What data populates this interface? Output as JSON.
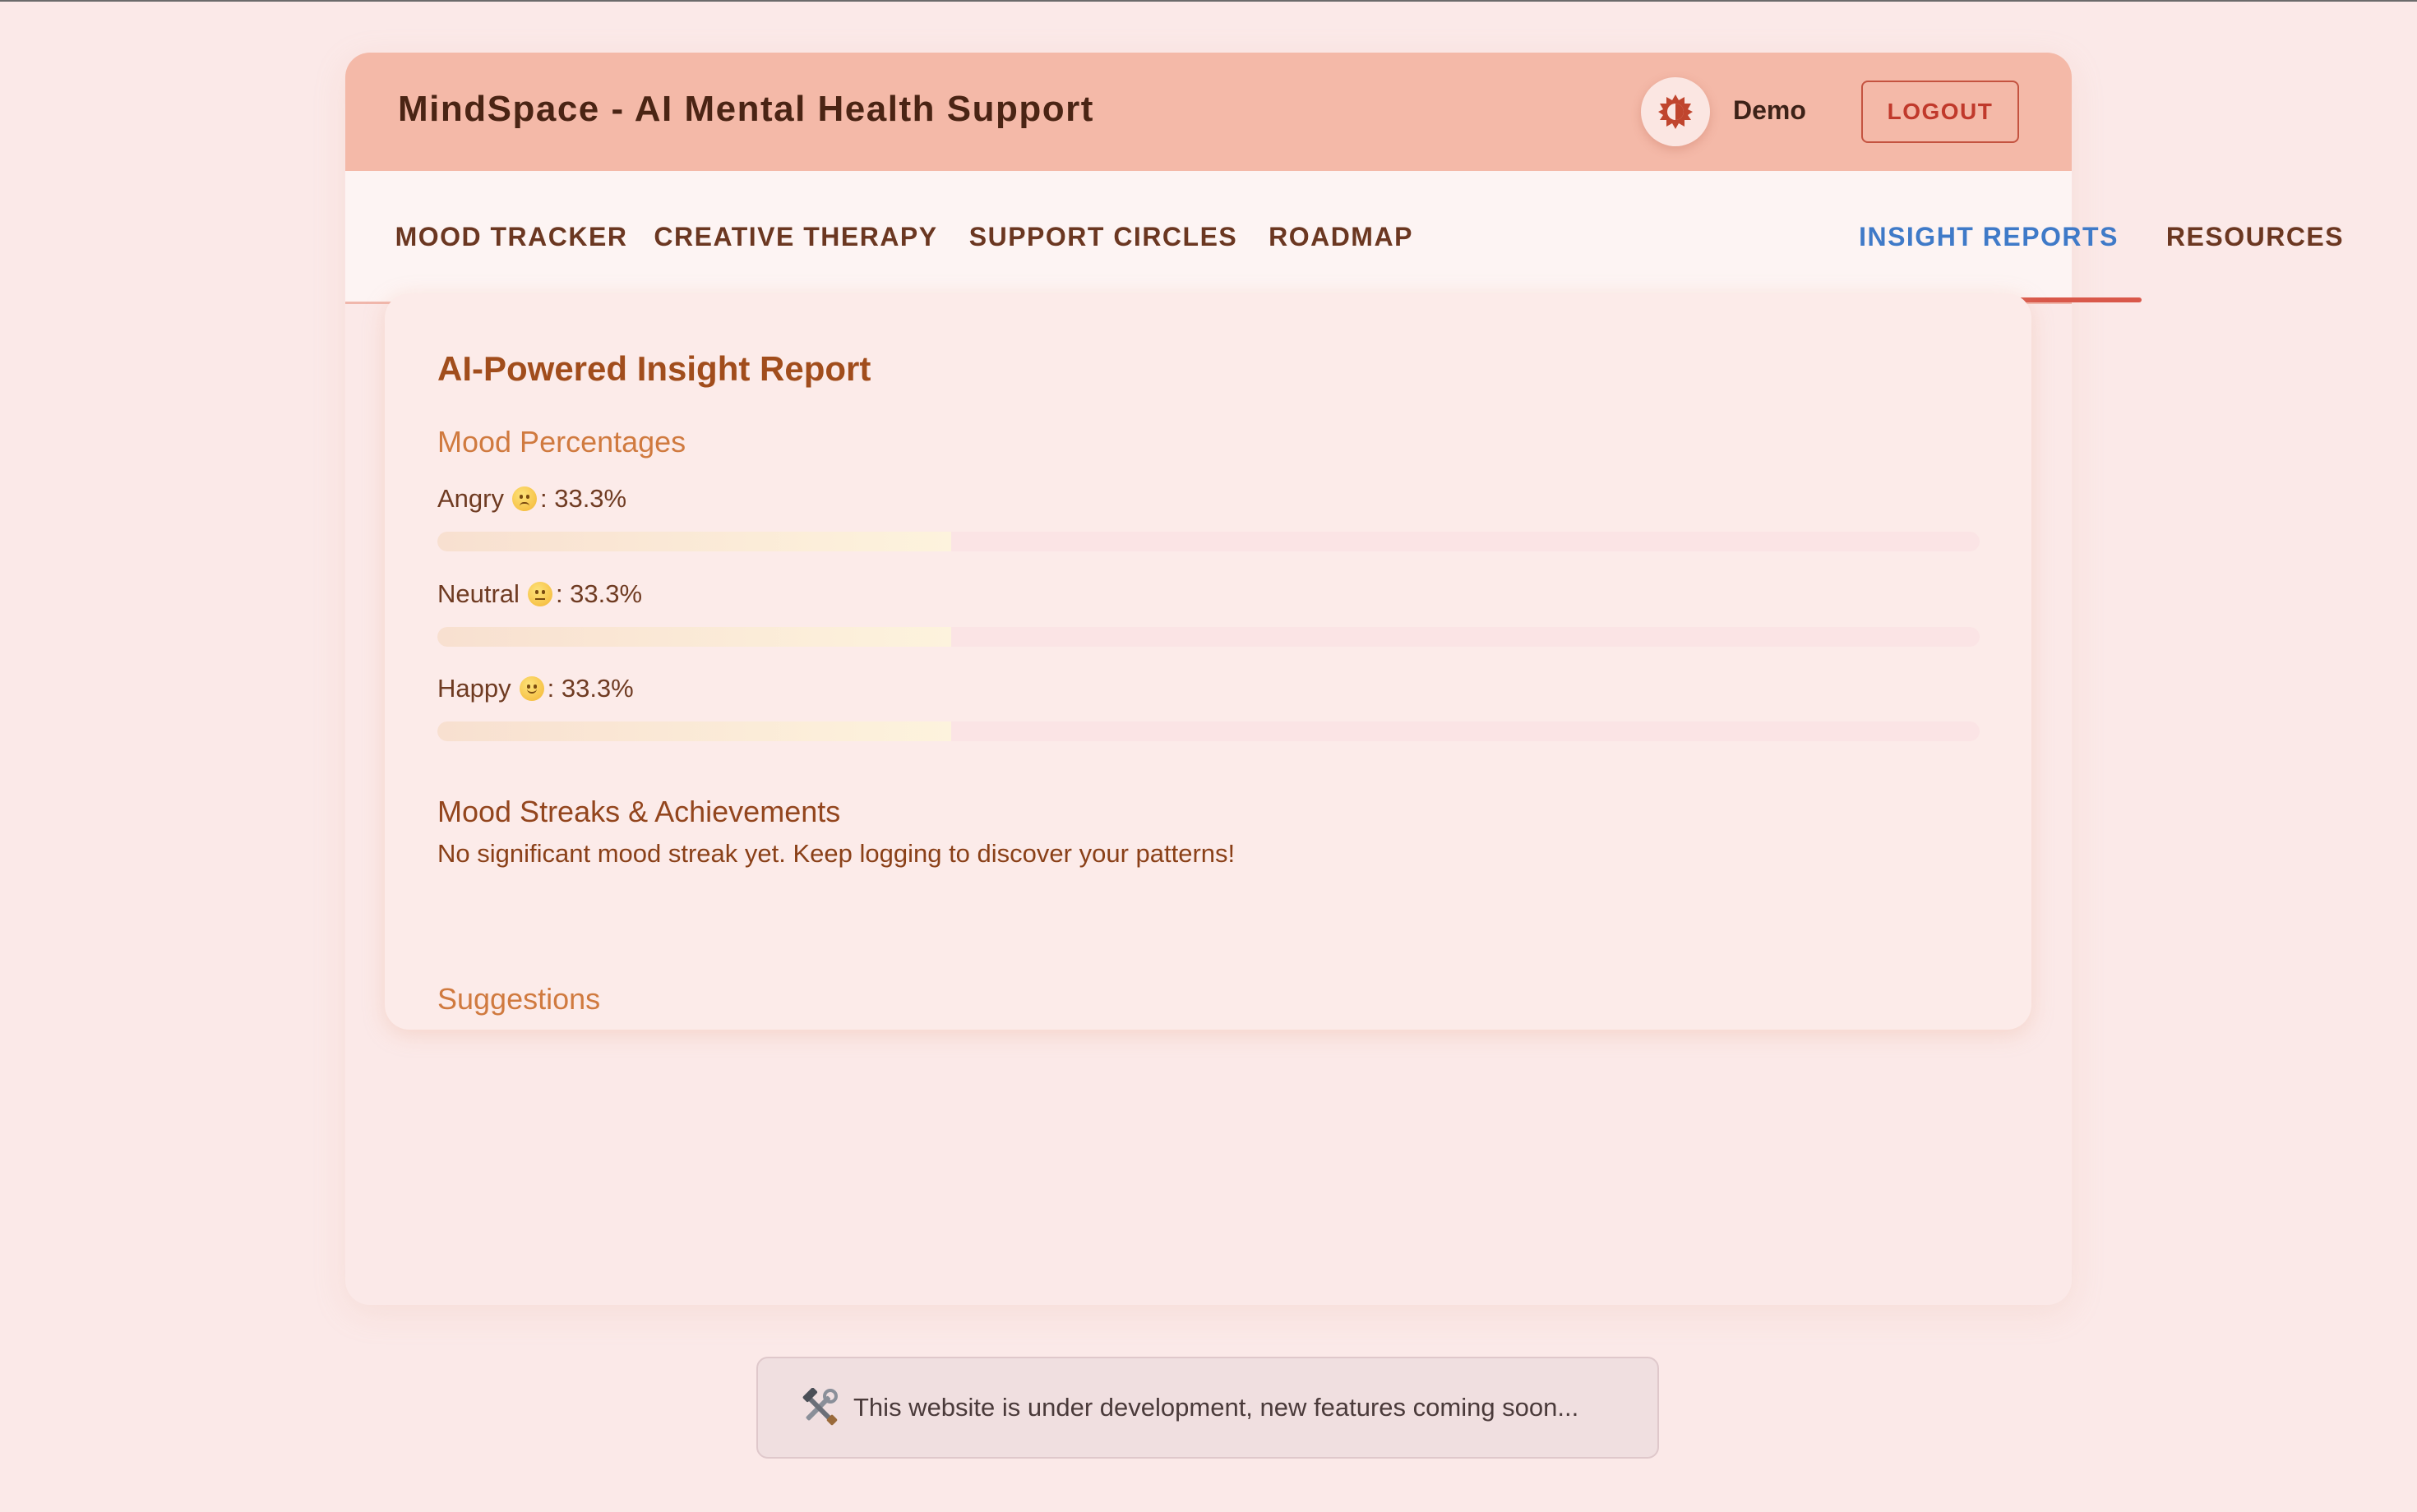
{
  "app": {
    "title": "MindSpace - AI Mental Health Support",
    "user_name": "Demo",
    "logout_label": "LOGOUT",
    "theme_icon": "sun-moon-icon"
  },
  "nav": {
    "active": "INSIGHT REPORTS",
    "tabs": [
      {
        "label": "MOOD TRACKER"
      },
      {
        "label": "CREATIVE THERAPY"
      },
      {
        "label": "SUPPORT CIRCLES"
      },
      {
        "label": "ROADMAP"
      },
      {
        "label": "INSIGHT REPORTS"
      },
      {
        "label": "RESOURCES"
      }
    ]
  },
  "report": {
    "title": "AI-Powered Insight Report",
    "mood_percentages_heading": "Mood Percentages",
    "moods": [
      {
        "name": "Angry",
        "emoji": "angry-face-icon",
        "value_text": ": 33.3%",
        "percent": 33.3
      },
      {
        "name": "Neutral",
        "emoji": "neutral-face-icon",
        "value_text": ": 33.3%",
        "percent": 33.3
      },
      {
        "name": "Happy",
        "emoji": "smiling-face-icon",
        "value_text": ": 33.3%",
        "percent": 33.3
      }
    ],
    "streaks_heading": "Mood Streaks & Achievements",
    "streak_message": "No significant mood streak yet. Keep logging to discover your patterns!",
    "suggestions_heading": "Suggestions"
  },
  "footer": {
    "icon": "hammer-and-wrench-icon",
    "message": "This website is under development, new features coming soon..."
  },
  "colors": {
    "background": "#fbe9e8",
    "header": "#f4b9a8",
    "active_tab": "#3f7ac8",
    "tab_indicator": "#d9584a",
    "logout": "#c0392b"
  }
}
